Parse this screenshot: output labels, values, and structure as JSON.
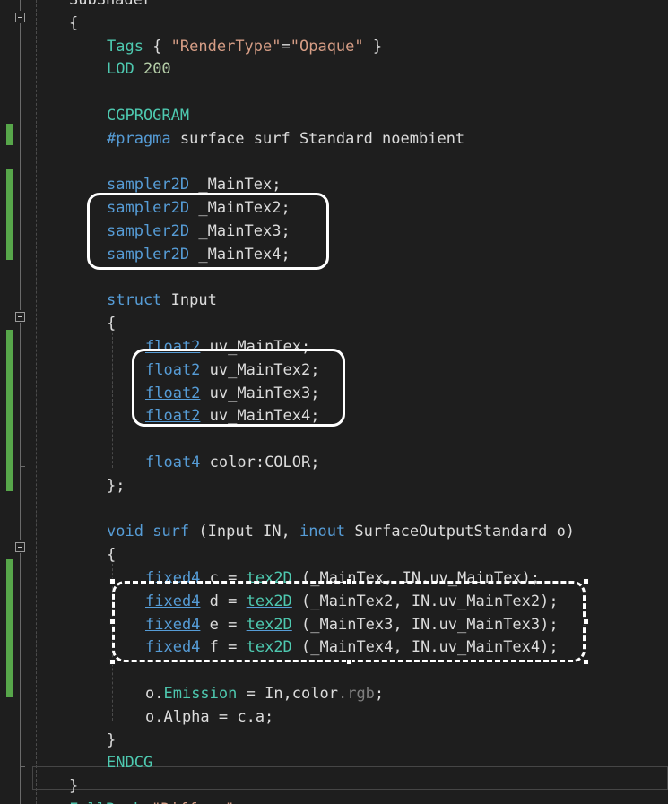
{
  "editor": {
    "lines": [
      {
        "id": "line-subshader",
        "segments": [
          [
            "pl",
            "SubShader"
          ]
        ]
      },
      {
        "id": "line-open-brace-1",
        "segments": [
          [
            "pl",
            "{"
          ]
        ]
      },
      {
        "id": "line-tags",
        "segments": [
          [
            "cgp",
            "Tags"
          ],
          [
            "pl",
            " { "
          ],
          [
            "str",
            "\"RenderType\""
          ],
          [
            "pl",
            "="
          ],
          [
            "str",
            "\"Opaque\""
          ],
          [
            "pl",
            " }"
          ]
        ]
      },
      {
        "id": "line-lod",
        "segments": [
          [
            "cgp",
            "LOD "
          ],
          [
            "num",
            "200"
          ]
        ]
      },
      {
        "id": "line-blank-1",
        "segments": []
      },
      {
        "id": "line-cgprogram",
        "segments": [
          [
            "cgp",
            "CGPROGRAM"
          ]
        ]
      },
      {
        "id": "line-pragma",
        "segments": [
          [
            "kw",
            "#pragma"
          ],
          [
            "pl",
            " surface surf Standard noembient"
          ]
        ]
      },
      {
        "id": "line-blank-2",
        "segments": []
      },
      {
        "id": "line-sampler-1",
        "segments": [
          [
            "kw",
            "sampler2D"
          ],
          [
            "pl",
            " _MainTex;"
          ]
        ]
      },
      {
        "id": "line-sampler-2",
        "segments": [
          [
            "kw",
            "sampler2D"
          ],
          [
            "pl",
            " _MainTex2;"
          ]
        ]
      },
      {
        "id": "line-sampler-3",
        "segments": [
          [
            "kw",
            "sampler2D"
          ],
          [
            "pl",
            " _MainTex3;"
          ]
        ]
      },
      {
        "id": "line-sampler-4",
        "segments": [
          [
            "kw",
            "sampler2D"
          ],
          [
            "pl",
            " _MainTex4;"
          ]
        ]
      },
      {
        "id": "line-blank-3",
        "segments": []
      },
      {
        "id": "line-struct",
        "segments": [
          [
            "kw",
            "struct"
          ],
          [
            "pl",
            " Input"
          ]
        ]
      },
      {
        "id": "line-open-brace-2",
        "segments": [
          [
            "pl",
            "{"
          ]
        ]
      },
      {
        "id": "line-uv-1",
        "segments": [
          [
            "kwul",
            "float2"
          ],
          [
            "pl",
            " uv_MainTex;"
          ]
        ]
      },
      {
        "id": "line-uv-2",
        "segments": [
          [
            "kwul",
            "float2"
          ],
          [
            "pl",
            " uv_MainTex2;"
          ]
        ]
      },
      {
        "id": "line-uv-3",
        "segments": [
          [
            "kwul",
            "float2"
          ],
          [
            "pl",
            " uv_MainTex3;"
          ]
        ]
      },
      {
        "id": "line-uv-4",
        "segments": [
          [
            "kwul",
            "float2"
          ],
          [
            "pl",
            " uv_MainTex4;"
          ]
        ]
      },
      {
        "id": "line-blank-4",
        "segments": []
      },
      {
        "id": "line-color",
        "segments": [
          [
            "kw",
            "float4"
          ],
          [
            "pl",
            " color:COLOR;"
          ]
        ]
      },
      {
        "id": "line-close-struct",
        "segments": [
          [
            "pl",
            "};"
          ]
        ]
      },
      {
        "id": "line-blank-5",
        "segments": []
      },
      {
        "id": "line-void-surf",
        "segments": [
          [
            "kw",
            "void"
          ],
          [
            "pl",
            " "
          ],
          [
            "kw",
            "surf"
          ],
          [
            "pl",
            " (Input IN, "
          ],
          [
            "kw",
            "inout"
          ],
          [
            "pl",
            " SurfaceOutputStandard o)"
          ]
        ]
      },
      {
        "id": "line-open-brace-3",
        "segments": [
          [
            "pl",
            "{"
          ]
        ]
      },
      {
        "id": "line-fixed-c",
        "segments": [
          [
            "kwul",
            "fixed4"
          ],
          [
            "pl",
            " c = "
          ],
          [
            "fnul",
            "tex2D"
          ],
          [
            "pl",
            " (_MainTex, IN.uv_MainTex);"
          ]
        ]
      },
      {
        "id": "line-fixed-d",
        "segments": [
          [
            "kwul",
            "fixed4"
          ],
          [
            "pl",
            " d = "
          ],
          [
            "fnul",
            "tex2D"
          ],
          [
            "pl",
            " (_MainTex2, IN.uv_MainTex2);"
          ]
        ]
      },
      {
        "id": "line-fixed-e",
        "segments": [
          [
            "kwul",
            "fixed4"
          ],
          [
            "pl",
            " e = "
          ],
          [
            "fnul",
            "tex2D"
          ],
          [
            "pl",
            " (_MainTex3, IN.uv_MainTex3);"
          ]
        ]
      },
      {
        "id": "line-fixed-f",
        "segments": [
          [
            "kwul",
            "fixed4"
          ],
          [
            "pl",
            " f = "
          ],
          [
            "fnul",
            "tex2D"
          ],
          [
            "pl",
            " (_MainTex4, IN.uv_MainTex4);"
          ]
        ]
      },
      {
        "id": "line-blank-6",
        "segments": []
      },
      {
        "id": "line-emission",
        "segments": [
          [
            "pl",
            "o."
          ],
          [
            "fn",
            "Emission"
          ],
          [
            "pl",
            " = In,color"
          ],
          [
            "dim",
            ".rgb"
          ],
          [
            "pl",
            ";"
          ]
        ]
      },
      {
        "id": "line-alpha",
        "segments": [
          [
            "pl",
            "o.Alpha = c.a;"
          ]
        ]
      },
      {
        "id": "line-close-brace-3",
        "segments": [
          [
            "pl",
            "}"
          ]
        ]
      },
      {
        "id": "line-endcg",
        "segments": [
          [
            "cgp",
            "ENDCG"
          ]
        ]
      },
      {
        "id": "line-close-brace-1",
        "segments": [
          [
            "pl",
            "}"
          ]
        ]
      },
      {
        "id": "line-fallback",
        "segments": [
          [
            "cgp",
            "FallBack"
          ],
          [
            "pl",
            " "
          ],
          [
            "str",
            "\"Diffuse\""
          ]
        ]
      }
    ]
  },
  "colors": {
    "background": "#1e1e1e",
    "keyword": "#569cd6",
    "type_func": "#4ec9b0",
    "string": "#d69d85",
    "number": "#b5cea8",
    "plain": "#dcdcdc",
    "change_marker": "#57a64a",
    "annotation_outline": "#ffffff"
  }
}
